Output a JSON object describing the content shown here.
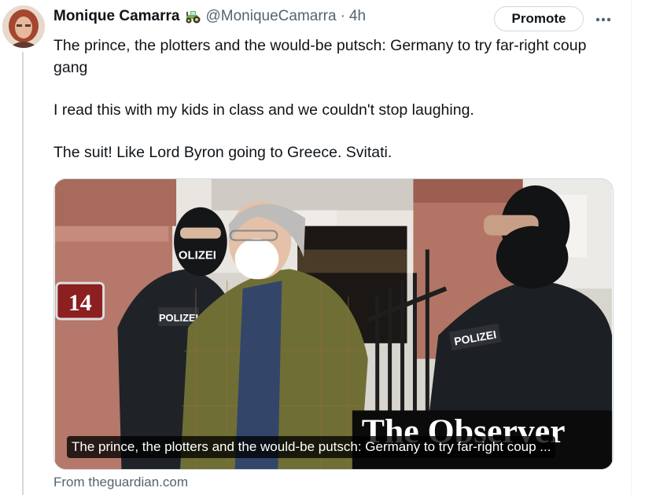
{
  "tweet": {
    "author_name": "Monique Camarra",
    "author_emoji_icon": "tractor-icon",
    "handle": "@MoniqueCamarra",
    "separator": "·",
    "time": "4h",
    "promote_label": "Promote",
    "more_icon": "more-horizontal-icon",
    "text_lines": [
      "The prince, the plotters and the would-be putsch: Germany to try far-right coup gang",
      "I read this with my kids in class and we couldn't stop laughing.",
      "The suit! Like Lord Byron going to Greece. Svitati."
    ]
  },
  "card": {
    "caption": "The prince, the plotters and the would-be putsch: Germany to try far-right coup ...",
    "source": "From theguardian.com",
    "photo": {
      "house_number": "14",
      "vest_labels": [
        "POLIZEI",
        "POLIZEI"
      ],
      "mask_label": "OLIZEI",
      "watermark": "The Observer"
    }
  },
  "colors": {
    "text_primary": "#0f1419",
    "text_secondary": "#536471",
    "border": "#cfd9de"
  }
}
